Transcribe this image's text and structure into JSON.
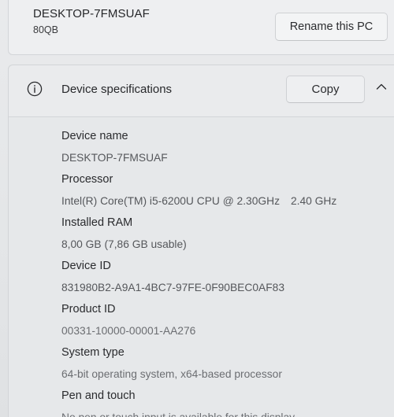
{
  "pc": {
    "name": "DESKTOP-7FMSUAF",
    "model": "80QB",
    "rename_label": "Rename this PC"
  },
  "specs_section": {
    "title": "Device specifications",
    "copy_label": "Copy",
    "collapse_icon": "chevron-up-icon",
    "info_icon": "info-icon",
    "items": [
      {
        "label": "Device name",
        "value": "DESKTOP-7FMSUAF"
      },
      {
        "label": "Processor",
        "value": "Intel(R) Core(TM) i5-6200U CPU @ 2.30GHz",
        "value_extra": "2.40 GHz"
      },
      {
        "label": "Installed RAM",
        "value": "8,00 GB (7,86 GB usable)"
      },
      {
        "label": "Device ID",
        "value": "831980B2-A9A1-4BC7-97FE-0F90BEC0AF83"
      },
      {
        "label": "Product ID",
        "value": "00331-10000-00001-AA276"
      },
      {
        "label": "System type",
        "value": "64-bit operating system, x64-based processor"
      },
      {
        "label": "Pen and touch",
        "value": "No pen or touch input is available for this display"
      }
    ]
  }
}
